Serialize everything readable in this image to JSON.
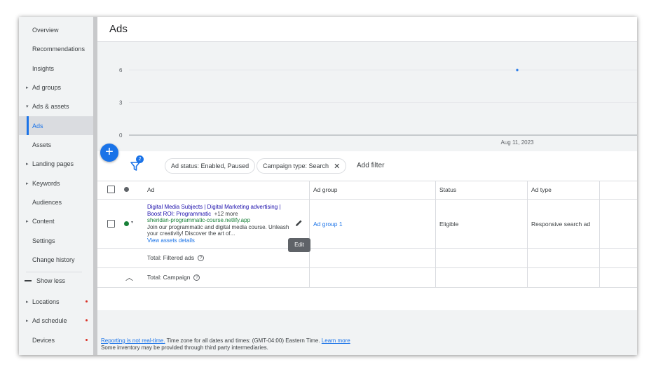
{
  "sidebar": {
    "items": [
      {
        "label": "Overview",
        "arrow": "",
        "dot": false
      },
      {
        "label": "Recommendations",
        "arrow": "",
        "dot": false
      },
      {
        "label": "Insights",
        "arrow": "",
        "dot": false
      },
      {
        "label": "Ad groups",
        "arrow": "▸",
        "dot": false
      },
      {
        "label": "Ads & assets",
        "arrow": "▾",
        "dot": false
      },
      {
        "label": "Ads",
        "arrow": "",
        "dot": false,
        "active": true
      },
      {
        "label": "Assets",
        "arrow": "",
        "dot": false
      },
      {
        "label": "Landing pages",
        "arrow": "▸",
        "dot": false
      },
      {
        "label": "Keywords",
        "arrow": "▸",
        "dot": false
      },
      {
        "label": "Audiences",
        "arrow": "",
        "dot": false
      },
      {
        "label": "Content",
        "arrow": "▸",
        "dot": false
      },
      {
        "label": "Settings",
        "arrow": "",
        "dot": false
      },
      {
        "label": "Change history",
        "arrow": "",
        "dot": false
      }
    ],
    "show_less": "Show less",
    "extra_items": [
      {
        "label": "Locations",
        "arrow": "▸",
        "dot": true
      },
      {
        "label": "Ad schedule",
        "arrow": "▸",
        "dot": true
      },
      {
        "label": "Devices",
        "arrow": "",
        "dot": true
      }
    ]
  },
  "header": {
    "title": "Ads"
  },
  "chart_data": {
    "type": "scatter",
    "y_ticks": [
      "6",
      "3",
      "0"
    ],
    "x_tick": "Aug 11, 2023",
    "points": [
      {
        "x": "Aug 11, 2023",
        "y": 6
      }
    ],
    "ylim": [
      0,
      6
    ],
    "point_color": "#1a73e8"
  },
  "filters": {
    "badge_count": "2",
    "chips": [
      "Ad status: Enabled, Paused",
      "Campaign type: Search"
    ],
    "add_filter": "Add filter"
  },
  "table": {
    "columns": [
      "Ad",
      "Ad group",
      "Status",
      "Ad type"
    ],
    "row": {
      "headline": "Digital Media Subjects | Digital Marketing advertising | Boost ROI: Programmatic",
      "more": "+12 more",
      "url": "sheridan-programmatic-course.netlify.app",
      "description": "Join our programmatic and digital media course. Unleash your creativity! Discover the art of...",
      "assets_link": "View assets details",
      "ad_group": "Ad group 1",
      "status": "Eligible",
      "ad_type": "Responsive search ad",
      "status_color": "#188038"
    },
    "edit_tooltip": "Edit",
    "total_filtered": "Total: Filtered ads",
    "total_campaign": "Total: Campaign"
  },
  "footer": {
    "reporting_link": "Reporting is not real-time.",
    "timezone_text": " Time zone for all dates and times: (GMT-04:00) Eastern Time. ",
    "learn_more": "Learn more",
    "inventory_text": "Some inventory may be provided through third party intermediaries."
  }
}
